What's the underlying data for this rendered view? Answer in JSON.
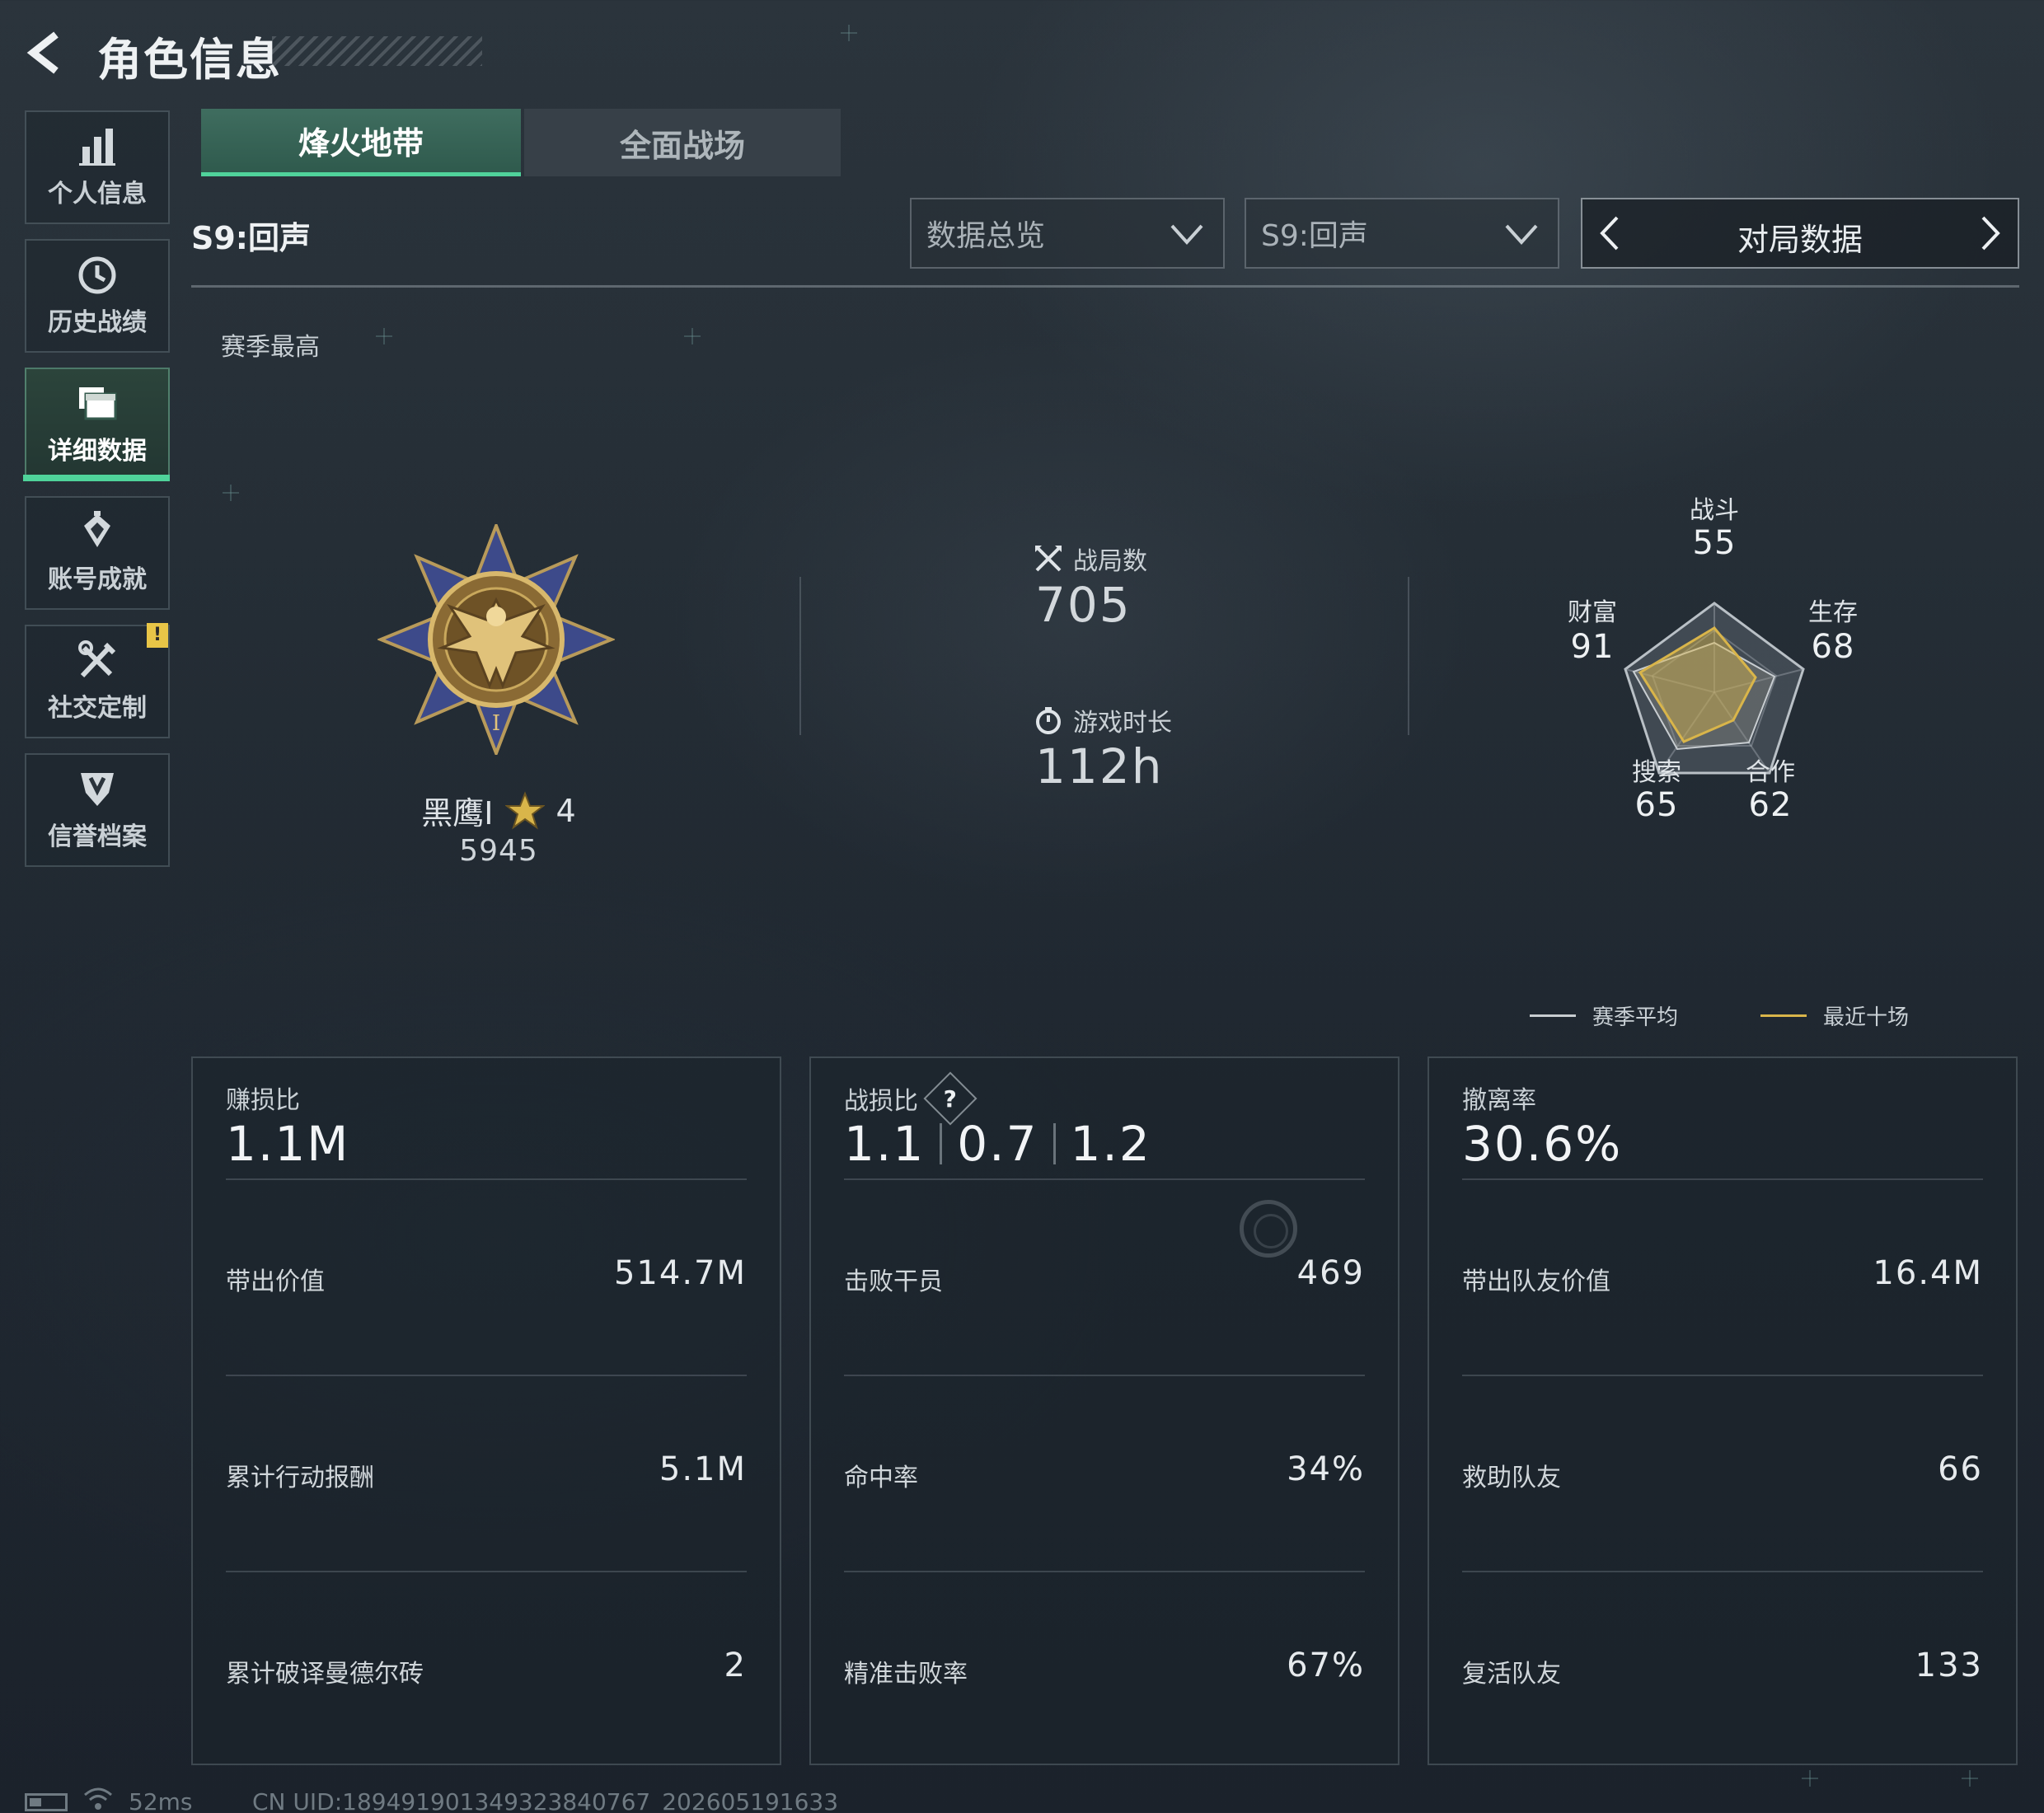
{
  "header": {
    "title": "角色信息"
  },
  "sidebar": {
    "items": [
      {
        "label": "个人信息",
        "icon": "bar-chart-icon"
      },
      {
        "label": "历史战绩",
        "icon": "history-clock-icon"
      },
      {
        "label": "详细数据",
        "icon": "folders-icon",
        "active": true
      },
      {
        "label": "账号成就",
        "icon": "achievement-icon"
      },
      {
        "label": "社交定制",
        "icon": "tools-icon",
        "badge": "!"
      },
      {
        "label": "信誉档案",
        "icon": "shield-icon"
      }
    ]
  },
  "tabs": [
    {
      "label": "烽火地带",
      "active": true
    },
    {
      "label": "全面战场",
      "active": false
    }
  ],
  "season_label": "S9:回声",
  "filters": {
    "dropdown_type": "数据总览",
    "dropdown_season": "S9:回声",
    "pager_label": "对局数据"
  },
  "best": {
    "title": "赛季最高",
    "rank_name": "黑鹰I",
    "stars": "4",
    "score": "5945"
  },
  "overview": {
    "matches_label": "战局数",
    "matches_value": "705",
    "playtime_label": "游戏时长",
    "playtime_value": "112h"
  },
  "radar": {
    "axes": [
      {
        "name": "战斗",
        "value": "55"
      },
      {
        "name": "生存",
        "value": "68"
      },
      {
        "name": "合作",
        "value": "62"
      },
      {
        "name": "搜索",
        "value": "65"
      },
      {
        "name": "财富",
        "value": "91"
      }
    ],
    "legend": [
      {
        "label": "赛季平均",
        "color": "#c8cdd1"
      },
      {
        "label": "最近十场",
        "color": "#d9b54a"
      }
    ]
  },
  "panels": [
    {
      "head_label": "赚损比",
      "head_value": "1.1M",
      "rows": [
        {
          "label": "带出价值",
          "value": "514.7M"
        },
        {
          "label": "累计行动报酬",
          "value": "5.1M"
        },
        {
          "label": "累计破译曼德尔砖",
          "value": "2"
        }
      ]
    },
    {
      "head_label": "战损比",
      "help": "?",
      "head_values": [
        "1.1",
        "0.7",
        "1.2"
      ],
      "rows": [
        {
          "label": "击败干员",
          "value": "469"
        },
        {
          "label": "命中率",
          "value": "34%"
        },
        {
          "label": "精准击败率",
          "value": "67%"
        }
      ]
    },
    {
      "head_label": "撤离率",
      "head_value": "30.6%",
      "rows": [
        {
          "label": "带出队友价值",
          "value": "16.4M"
        },
        {
          "label": "救助队友",
          "value": "66"
        },
        {
          "label": "复活队友",
          "value": "133"
        }
      ]
    }
  ],
  "footer": {
    "ping": "52ms",
    "uid": "CN UID:18949190134932384076​7_202605191633"
  },
  "colors": {
    "accent_green": "#4fd39a",
    "warning_yellow": "#e8c547",
    "radar_gold": "#d9b54a"
  }
}
